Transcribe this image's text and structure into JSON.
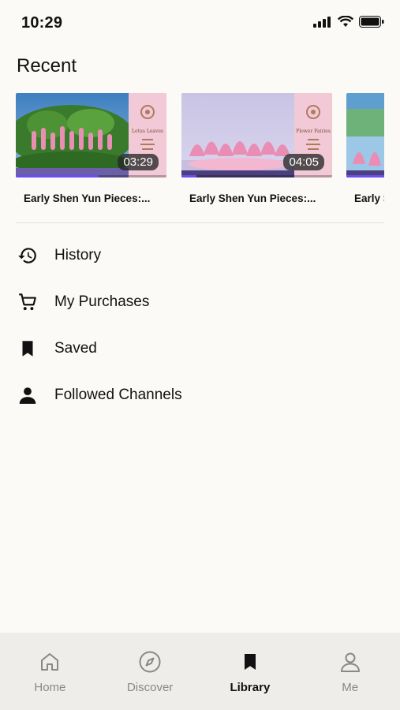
{
  "status_bar": {
    "time": "10:29"
  },
  "recent": {
    "title": "Recent",
    "items": [
      {
        "title": "Early Shen Yun Pieces:...",
        "duration": "03:29",
        "progress": 0.55,
        "poster_text": "Lotus Leaves"
      },
      {
        "title": "Early Shen Yun Pieces:...",
        "duration": "04:05",
        "progress": 0.1,
        "poster_text": "Flower Fairies"
      },
      {
        "title": "Early Shen Yun Pieces:...",
        "duration": "",
        "progress": 0.6,
        "poster_text": ""
      }
    ]
  },
  "menu": [
    {
      "label": "History",
      "icon": "history-icon"
    },
    {
      "label": "My Purchases",
      "icon": "cart-icon"
    },
    {
      "label": "Saved",
      "icon": "bookmark-icon"
    },
    {
      "label": "Followed Channels",
      "icon": "person-icon"
    }
  ],
  "tabs": [
    {
      "label": "Home",
      "icon": "home-icon",
      "active": false
    },
    {
      "label": "Discover",
      "icon": "compass-icon",
      "active": false
    },
    {
      "label": "Library",
      "icon": "bookmark-icon",
      "active": true
    },
    {
      "label": "Me",
      "icon": "person-icon",
      "active": false
    }
  ],
  "colors": {
    "background": "#fbfaf6",
    "tabbar": "#efede9",
    "progress": "#6a4cf0",
    "poster_pink": "#f2c9d6"
  }
}
